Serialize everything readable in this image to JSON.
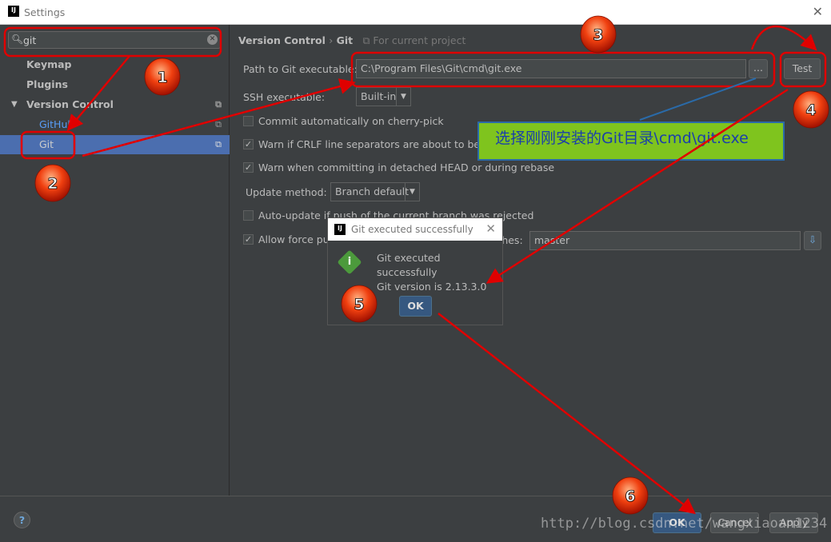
{
  "window": {
    "title": "Settings",
    "logo": "IJ",
    "close_icon": "close-icon"
  },
  "sidebar": {
    "search_value": "git",
    "items": [
      {
        "label": "Keymap"
      },
      {
        "label": "Plugins"
      },
      {
        "label": "Version Control"
      },
      {
        "label": "GitHub"
      },
      {
        "label": "Git",
        "selected": true
      }
    ]
  },
  "main": {
    "breadcrumb": {
      "section": "Version Control",
      "sep": "›",
      "page": "Git",
      "scope": "For current project"
    },
    "path_label": "Path to Git executable:",
    "path_value": "C:\\Program Files\\Git\\cmd\\git.exe",
    "browse_label": "...",
    "test_label": "Test",
    "ssh_label": "SSH executable:",
    "ssh_value": "Built-in",
    "options": [
      {
        "label": "Commit automatically on cherry-pick",
        "checked": false
      },
      {
        "label": "Warn if CRLF line separators are about to be committed",
        "checked": true
      },
      {
        "label": "Warn when committing in detached HEAD or during rebase",
        "checked": true
      }
    ],
    "update_label": "Update method:",
    "update_value": "Branch default",
    "autoupdate_label": "Auto-update if push of the current branch was rejected",
    "autoupdate_checked": false,
    "force_label": "Allow force push",
    "force_checked": true,
    "protected_label": "Protected branches:",
    "protected_value": "master"
  },
  "popup": {
    "title": "Git executed successfully",
    "line1": "Git executed successfully",
    "line2": "Git version is 2.13.3.0",
    "ok": "OK"
  },
  "footer": {
    "help": "?",
    "ok": "OK",
    "cancel": "Cancel",
    "apply": "Apply"
  },
  "annotation": {
    "note": "选择刚刚安装的Git目录\\cmd\\git.exe",
    "steps": [
      "1",
      "2",
      "3",
      "4",
      "5",
      "6"
    ],
    "color": "#e00000"
  },
  "watermark": "http://blog.csdn.net/wangxiaoan1234"
}
